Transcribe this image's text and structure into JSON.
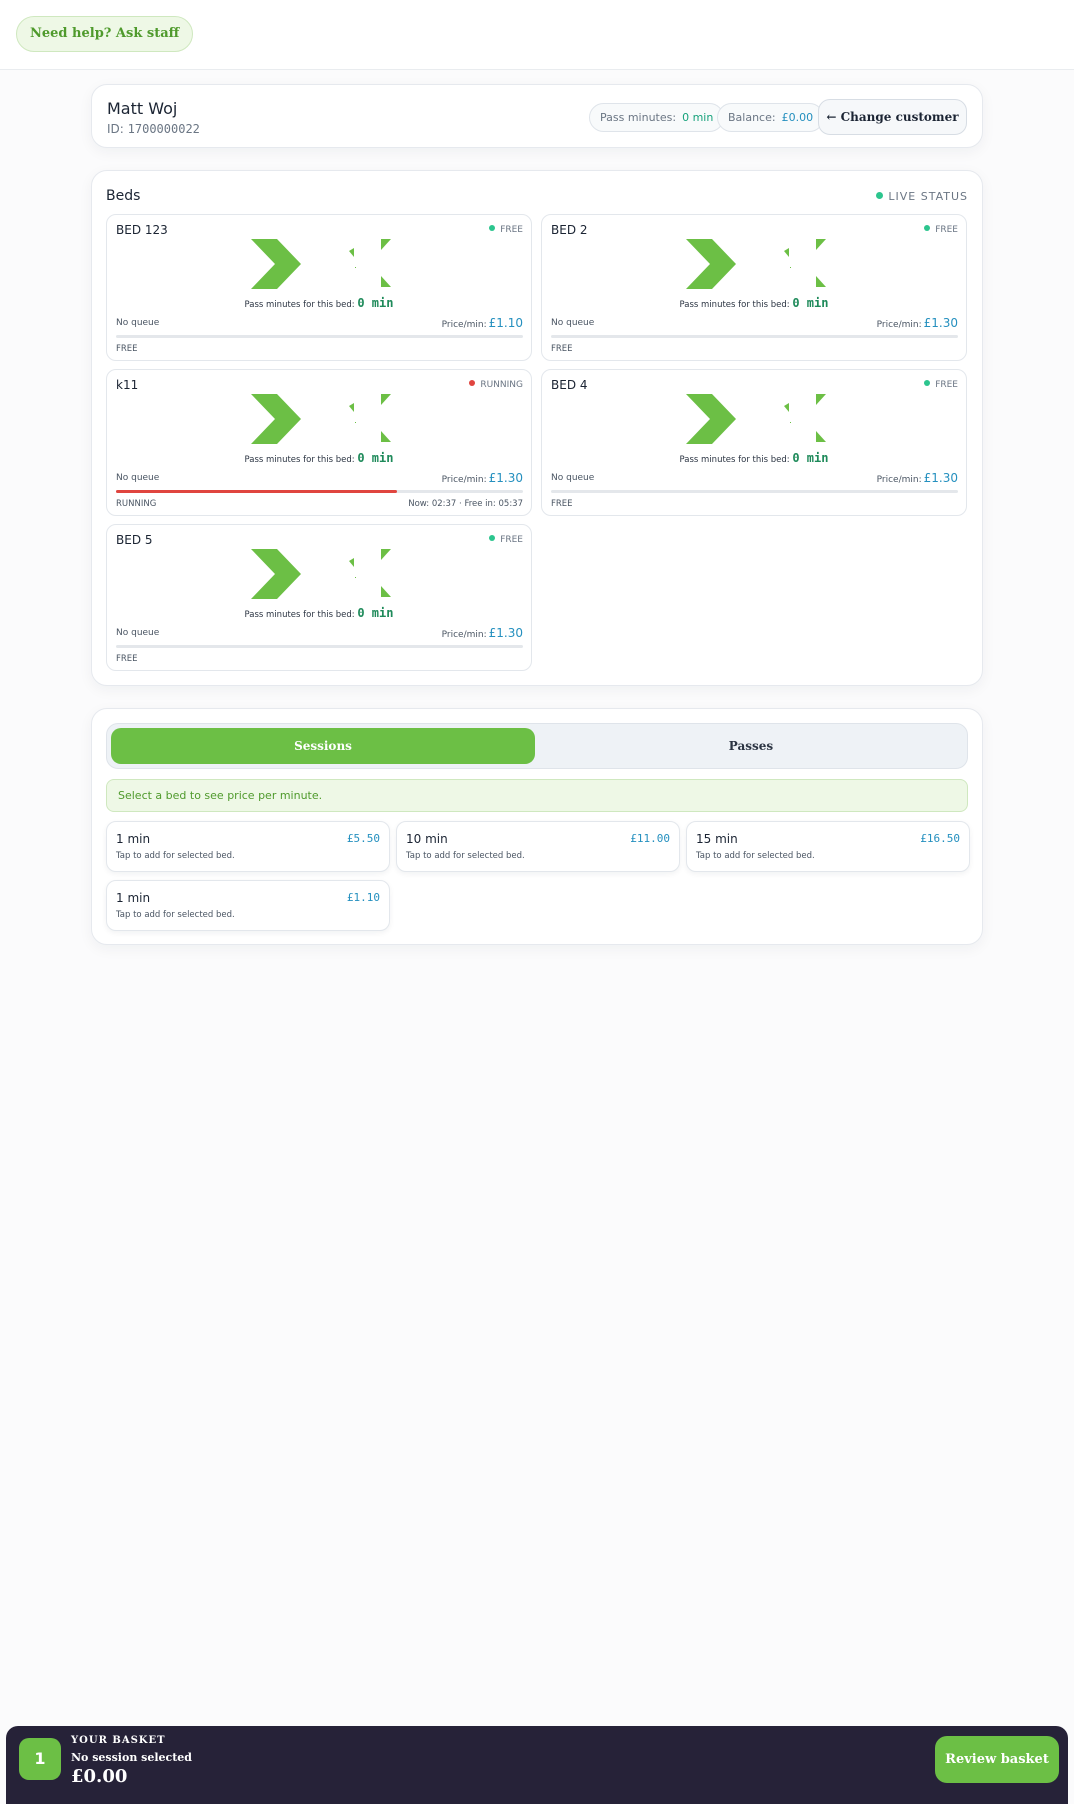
{
  "header": {
    "help_label": "Need help? Ask staff"
  },
  "customer": {
    "name": "Matt Woj",
    "id_label": "ID:",
    "id": "1700000022",
    "pass_label": "Pass minutes:",
    "pass_value": "0 min",
    "balance_label": "Balance:",
    "balance_value": "£0.00",
    "change_label": "← Change customer"
  },
  "beds_panel": {
    "title": "Beds",
    "live_label": "LIVE STATUS",
    "pass_text": "Pass minutes for this bed:",
    "price_label": "Price/min:",
    "status_colors": {
      "FREE": "#2cc58e",
      "RUNNING": "#e0453f"
    },
    "beds": [
      {
        "name": "BED 123",
        "status": "FREE",
        "pass_minutes": "0 min",
        "queue": "No queue",
        "price": "£1.10",
        "footer": "FREE",
        "footer_right": "",
        "progress": 0
      },
      {
        "name": "BED 2",
        "status": "FREE",
        "pass_minutes": "0 min",
        "queue": "No queue",
        "price": "£1.30",
        "footer": "FREE",
        "footer_right": "",
        "progress": 0
      },
      {
        "name": "k11",
        "status": "RUNNING",
        "pass_minutes": "0 min",
        "queue": "No queue",
        "price": "£1.30",
        "footer": "RUNNING",
        "footer_right": "Now: 02:37 · Free in: 05:37",
        "progress": 0.69
      },
      {
        "name": "BED 4",
        "status": "FREE",
        "pass_minutes": "0 min",
        "queue": "No queue",
        "price": "£1.30",
        "footer": "FREE",
        "footer_right": "",
        "progress": 0
      },
      {
        "name": "BED 5",
        "status": "FREE",
        "pass_minutes": "0 min",
        "queue": "No queue",
        "price": "£1.30",
        "footer": "FREE",
        "footer_right": "",
        "progress": 0
      }
    ]
  },
  "purchase": {
    "tabs": [
      {
        "label": "Sessions",
        "active": true
      },
      {
        "label": "Passes",
        "active": false
      }
    ],
    "notice": "Select a bed to see price per minute.",
    "hint": "Tap to add for selected bed.",
    "packages": [
      {
        "name": "1 min",
        "price": "£5.50"
      },
      {
        "name": "10 min",
        "price": "£11.00"
      },
      {
        "name": "15 min",
        "price": "£16.50"
      },
      {
        "name": "1 min",
        "price": "£1.10"
      }
    ]
  },
  "basket": {
    "count": "1",
    "label": "YOUR BASKET",
    "selection": "No session selected",
    "total": "£0.00",
    "review_label": "Review basket"
  },
  "colors": {
    "accent": "#6cbf45",
    "price": "#2590bf",
    "running": "#e0453f",
    "free": "#2cc58e",
    "basket_bg": "#262238"
  },
  "icons": {
    "bed_logo": "green-chevron-logo-icon"
  }
}
